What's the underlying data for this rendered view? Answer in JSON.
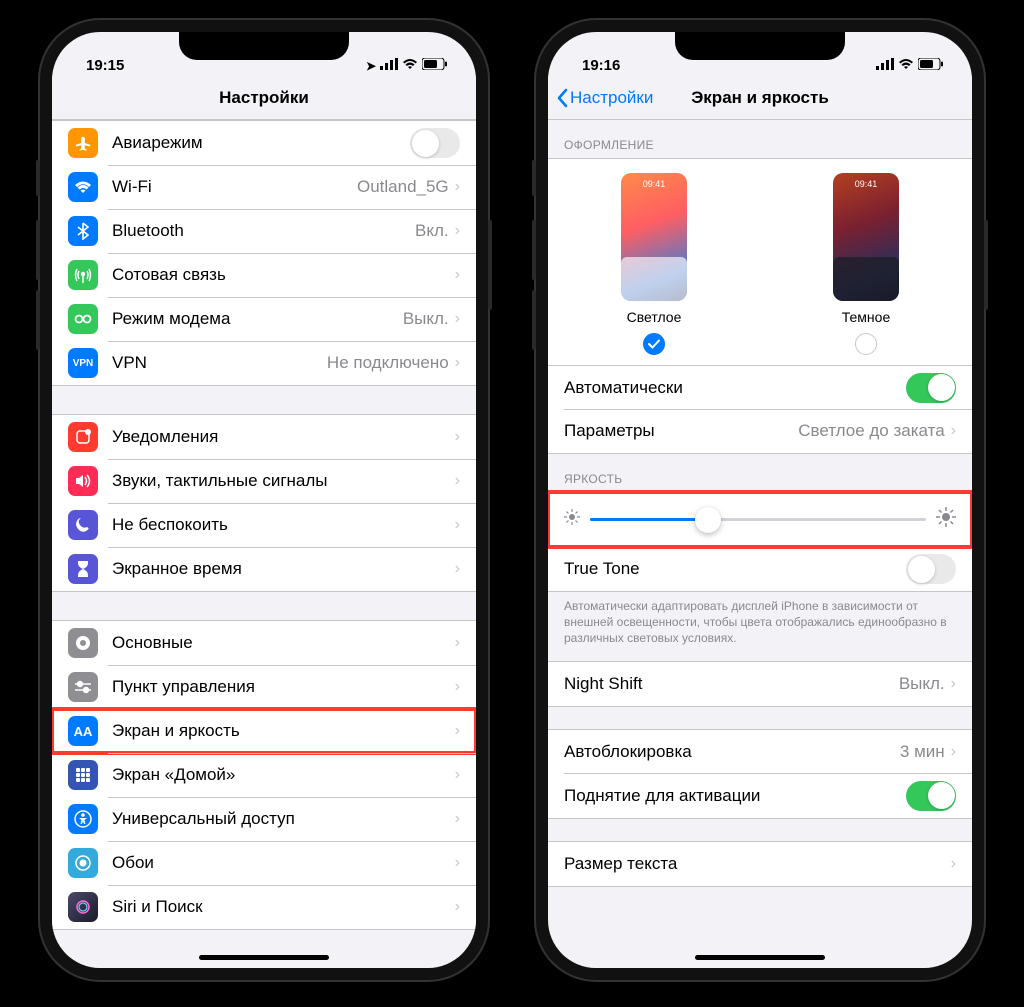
{
  "phone1": {
    "status_time": "19:15",
    "nav_title": "Настройки",
    "rows": {
      "airplane": "Авиарежим",
      "wifi": "Wi-Fi",
      "wifi_value": "Outland_5G",
      "bluetooth": "Bluetooth",
      "bluetooth_value": "Вкл.",
      "cellular": "Сотовая связь",
      "hotspot": "Режим модема",
      "hotspot_value": "Выкл.",
      "vpn": "VPN",
      "vpn_value": "Не подключено",
      "notifications": "Уведомления",
      "sounds": "Звуки, тактильные сигналы",
      "dnd": "Не беспокоить",
      "screentime": "Экранное время",
      "general": "Основные",
      "control": "Пункт управления",
      "display": "Экран и яркость",
      "home": "Экран «Домой»",
      "accessibility": "Универсальный доступ",
      "wallpaper": "Обои",
      "siri": "Siri и Поиск"
    },
    "vpn_badge": "VPN"
  },
  "phone2": {
    "status_time": "19:16",
    "nav_back": "Настройки",
    "nav_title": "Экран и яркость",
    "section_appearance": "ОФОРМЛЕНИЕ",
    "appearance": {
      "mini_time": "09:41",
      "light_label": "Светлое",
      "dark_label": "Темное"
    },
    "auto_label": "Автоматически",
    "params_label": "Параметры",
    "params_value": "Светлое до заката",
    "section_brightness": "ЯРКОСТЬ",
    "brightness_percent": 35,
    "truetone_label": "True Tone",
    "truetone_footer": "Автоматически адаптировать дисплей iPhone в зависимости от внешней освещенности, чтобы цвета отображались единообразно в различных световых условиях.",
    "nightshift_label": "Night Shift",
    "nightshift_value": "Выкл.",
    "autolock_label": "Автоблокировка",
    "autolock_value": "3 мин",
    "raise_label": "Поднятие для активации",
    "textsize_label": "Размер текста"
  },
  "icon_colors": {
    "airplane": "#ff9500",
    "wifi": "#007aff",
    "bluetooth": "#007aff",
    "cellular": "#34c759",
    "hotspot": "#34c759",
    "vpn": "#007aff",
    "notifications": "#ff3b30",
    "sounds": "#ff2d55",
    "dnd": "#5856d6",
    "screentime": "#5856d6",
    "general": "#8e8e93",
    "control": "#8e8e93",
    "display": "#007aff",
    "home": "#3455b4",
    "accessibility": "#007aff",
    "wallpaper": "#34aadc",
    "siri": "#1c1c1e"
  }
}
